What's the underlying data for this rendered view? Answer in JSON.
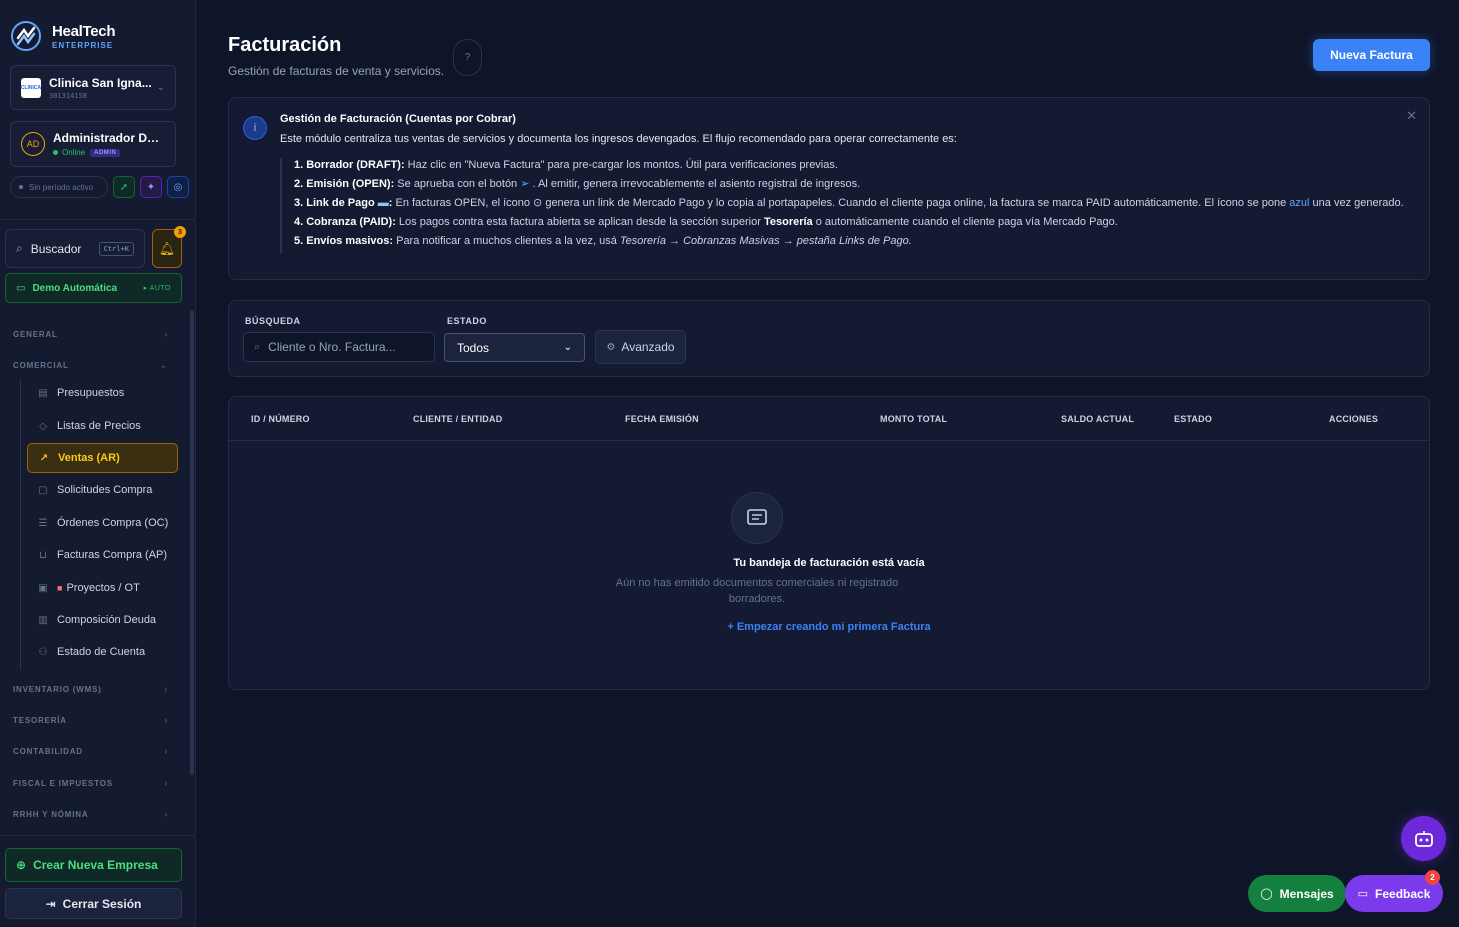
{
  "brand": {
    "name": "HealTech",
    "sub": "ENTERPRISE"
  },
  "org": {
    "thumb": "CLINICA",
    "name": "Clinica San Igna...",
    "id": "301314158"
  },
  "user": {
    "initials": "AD",
    "name": "Administrador De...",
    "status": "Online",
    "role": "ADMIN"
  },
  "period": {
    "label": "Sin período activo"
  },
  "search": {
    "label": "Buscador",
    "shortcut": "Ctrl+K"
  },
  "notifications": {
    "count": "3"
  },
  "demo": {
    "label": "Demo Automática",
    "tag": "▸ AUTO"
  },
  "nav": {
    "groups": {
      "general": "GENERAL",
      "comercial": "COMERCIAL",
      "inventario": "INVENTARIO (WMS)",
      "tesoreria": "TESORERÍA",
      "contabilidad": "CONTABILIDAD",
      "fiscal": "FISCAL E IMPUESTOS",
      "rrhh": "RRHH Y NÓMINA"
    },
    "items": [
      {
        "label": "Presupuestos"
      },
      {
        "label": "Listas de Precios"
      },
      {
        "label": "Ventas (AR)"
      },
      {
        "label": "Solicitudes Compra"
      },
      {
        "label": "Órdenes Compra (OC)"
      },
      {
        "label": "Facturas Compra (AP)"
      },
      {
        "label": "Proyectos / OT"
      },
      {
        "label": "Composición Deuda"
      },
      {
        "label": "Estado de Cuenta"
      }
    ]
  },
  "footer": {
    "create": "Crear Nueva Empresa",
    "logout": "Cerrar Sesión"
  },
  "page": {
    "title": "Facturación",
    "subtitle": "Gestión de facturas de venta y servicios.",
    "primary": "Nueva Factura"
  },
  "info": {
    "title": "Gestión de Facturación (Cuentas por Cobrar)",
    "intro": "Este módulo centraliza tus ventas de servicios y documenta los ingresos devengados. El flujo recomendado para operar correctamente es:",
    "s1_title": "1. Borrador (DRAFT):",
    "s1_text": " Haz clic en \"Nueva Factura\" para pre-cargar los montos. Útil para verificaciones previas.",
    "s2_title": "2. Emisión (OPEN):",
    "s2_text_a": " Se aprueba con el botón ",
    "s2_text_b": " . Al emitir, genera irrevocablemente el asiento registral de ingresos.",
    "s3_title": "3. Link de Pago",
    "s3_text_a": " En facturas OPEN, el ícono ",
    "s3_text_b": " genera un link de Mercado Pago y lo copia al portapapeles. Cuando el cliente paga online, la factura se marca PAID automáticamente. El ícono se pone ",
    "s3_blue": "azul",
    "s3_text_c": " una vez generado.",
    "s4_title": "4. Cobranza (PAID):",
    "s4_text_a": " Los pagos contra esta factura abierta se aplican desde la sección superior ",
    "s4_bold": "Tesorería",
    "s4_text_b": " o automáticamente cuando el cliente paga vía Mercado Pago.",
    "s5_title": "5. Envíos masivos:",
    "s5_text": " Para notificar a muchos clientes a la vez, usá ",
    "s5_italic": "Tesorería → Cobranzas Masivas → pestaña Links de Pago."
  },
  "filters": {
    "search_label": "BÚSQUEDA",
    "search_placeholder": "Cliente o Nro. Factura...",
    "status_label": "ESTADO",
    "status_value": "Todos",
    "advanced": "Avanzado"
  },
  "table": {
    "columns": [
      "ID / NÚMERO",
      "CLIENTE / ENTIDAD",
      "FECHA EMISIÓN",
      "MONTO TOTAL",
      "SALDO ACTUAL",
      "ESTADO",
      "ACCIONES"
    ],
    "empty_title": "Tu bandeja de facturación está vacía",
    "empty_sub": "Aún no has emitido documentos comerciales ni registrado borradores.",
    "empty_link": "+ Empezar creando mi primera Factura"
  },
  "floating": {
    "messages": "Mensajes",
    "feedback": "Feedback",
    "feedback_count": "2"
  }
}
